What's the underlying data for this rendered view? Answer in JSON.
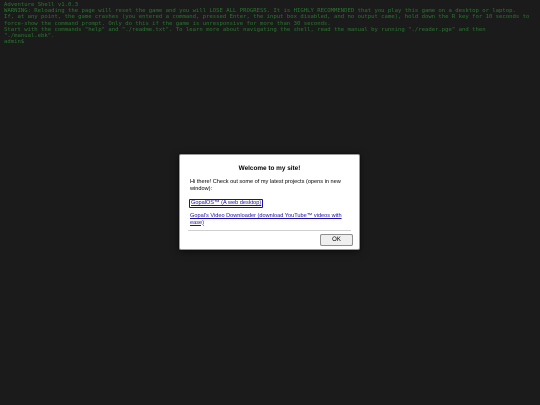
{
  "terminal": {
    "lines": [
      "Adventure Shell v1.0.3",
      "WARNING: Reloading the page will reset the game and you will LOSE ALL PROGRESS. It is HIGHLY RECOMMENDED that you play this game on a desktop or laptop.",
      "If, at any point, the game crashes (you entered a command, pressed Enter, the input box disabled, and no output came), hold down the R key for 10 seconds to force-show the command prompt. Only do this if the game is unresponsive for more than 30 seconds.",
      "Start with the commands \"help\" and \"./readme.txt\". To learn more about navigating the shell, read the manual by running \"./reader.pge\" and then \"./manual.ebk\".",
      "admin$"
    ],
    "text_color": "#3fbf4a",
    "background_color": "#2b2b2b"
  },
  "dialog": {
    "title": "Welcome to my site!",
    "message": "Hi there! Check out some of my latest projects (opens in new window):",
    "links": [
      {
        "label": "GopalOS™ (A web desktop)"
      },
      {
        "label": "Gopal's Video Downloader (download YouTube™ videos with ease)"
      }
    ],
    "ok_label": "OK"
  }
}
